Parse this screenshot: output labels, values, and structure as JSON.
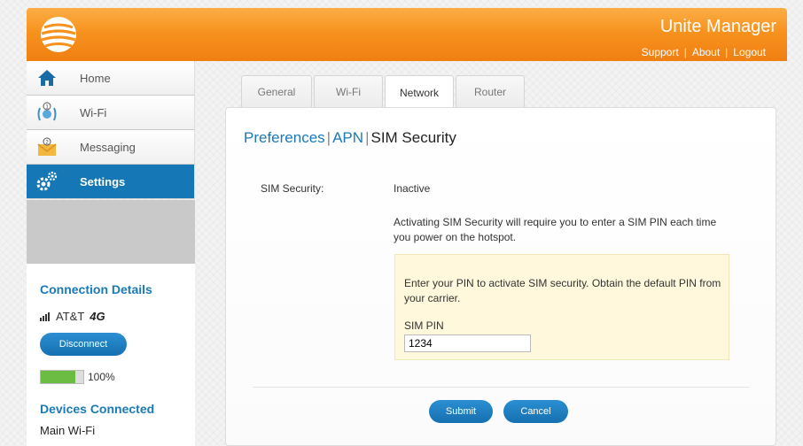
{
  "header": {
    "app_title": "Unite Manager",
    "links": [
      "Support",
      "About",
      "Logout"
    ],
    "brand_color": "#f7921e"
  },
  "nav": {
    "items": [
      {
        "label": "Home",
        "icon": "home-icon"
      },
      {
        "label": "Wi-Fi",
        "icon": "wifi-badge-icon"
      },
      {
        "label": "Messaging",
        "icon": "messaging-icon"
      },
      {
        "label": "Settings",
        "icon": "settings-icon",
        "active": true
      }
    ],
    "active_color": "#1577b6"
  },
  "connection": {
    "title": "Connection Details",
    "carrier": "AT&T",
    "network_badge": "4G",
    "disconnect_label": "Disconnect",
    "battery_percent": "100%",
    "battery_level": 1.0,
    "devices_title": "Devices Connected",
    "device_name": "Main Wi-Fi"
  },
  "tabs": [
    {
      "label": "General"
    },
    {
      "label": "Wi-Fi"
    },
    {
      "label": "Network",
      "active": true
    },
    {
      "label": "Router"
    }
  ],
  "content": {
    "breadcrumb": {
      "preferences": "Preferences",
      "apn": "APN",
      "current": "SIM Security",
      "separator": "|"
    },
    "sim_security_label": "SIM Security:",
    "sim_security_value": "Inactive",
    "info_text": "Activating SIM Security will require you to enter a SIM PIN each time you power on the hotspot.",
    "pin_message": "Enter your PIN to activate SIM security. Obtain the default PIN from your carrier.",
    "pin_label": "SIM PIN",
    "pin_value": "1234",
    "submit_label": "Submit",
    "cancel_label": "Cancel"
  }
}
